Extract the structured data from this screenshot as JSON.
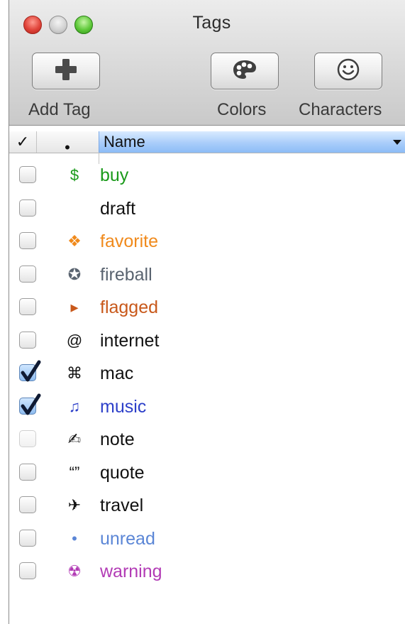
{
  "window": {
    "title": "Tags"
  },
  "toolbar": {
    "add_label": "Add Tag",
    "colors_label": "Colors",
    "characters_label": "Characters"
  },
  "table": {
    "headers": {
      "check": "✓",
      "symbol": "•",
      "name": "Name"
    },
    "rows": [
      {
        "name": "buy",
        "symbol": "$",
        "color": "#1a9a1a",
        "checked": false,
        "icon": "dollar-icon"
      },
      {
        "name": "draft",
        "symbol": "",
        "color": "#111111",
        "checked": false,
        "icon": ""
      },
      {
        "name": "favorite",
        "symbol": "❖",
        "color": "#f08a1c",
        "checked": false,
        "icon": "diamond-icon"
      },
      {
        "name": "fireball",
        "symbol": "✪",
        "color": "#5a6470",
        "checked": false,
        "icon": "star-circle-icon"
      },
      {
        "name": "flagged",
        "symbol": "▸",
        "color": "#c8581a",
        "checked": false,
        "icon": "triangle-icon"
      },
      {
        "name": "internet",
        "symbol": "@",
        "color": "#111111",
        "checked": false,
        "icon": "at-icon"
      },
      {
        "name": "mac",
        "symbol": "⌘",
        "color": "#111111",
        "checked": true,
        "icon": "command-icon"
      },
      {
        "name": "music",
        "symbol": "♫",
        "color": "#2c3fc9",
        "checked": true,
        "icon": "music-note-icon"
      },
      {
        "name": "note",
        "symbol": "✍",
        "color": "#111111",
        "checked": false,
        "icon": "writing-hand-icon",
        "dim": true
      },
      {
        "name": "quote",
        "symbol": "“”",
        "color": "#111111",
        "checked": false,
        "icon": "quote-icon"
      },
      {
        "name": "travel",
        "symbol": "✈",
        "color": "#111111",
        "checked": false,
        "icon": "airplane-icon"
      },
      {
        "name": "unread",
        "symbol": "•",
        "color": "#5b86d6",
        "checked": false,
        "icon": "dot-icon"
      },
      {
        "name": "warning",
        "symbol": "☢",
        "color": "#b23bb5",
        "checked": false,
        "icon": "radiation-icon"
      }
    ]
  }
}
